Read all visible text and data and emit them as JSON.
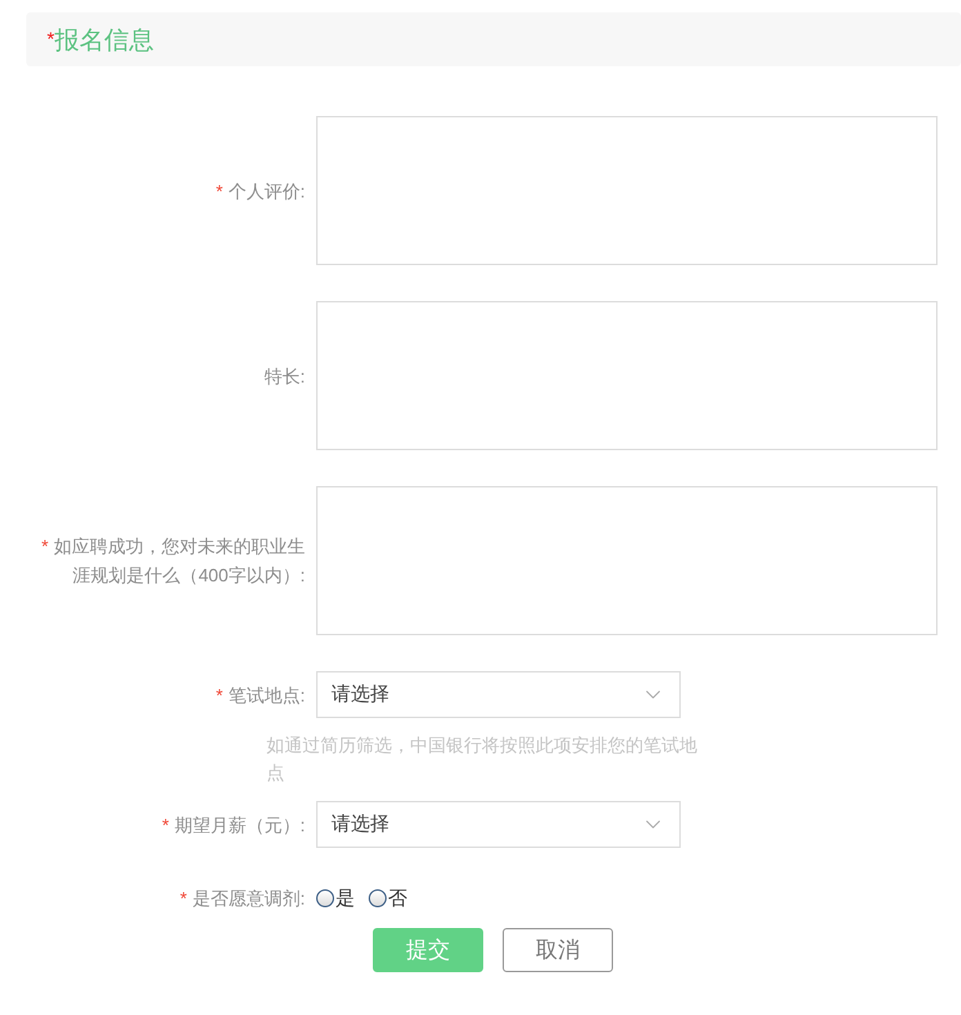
{
  "section": {
    "mark": "*",
    "title": "报名信息"
  },
  "fields": [
    {
      "kind": "textarea",
      "mark": "*",
      "label": "个人评价:"
    },
    {
      "kind": "textarea",
      "label": "特长:"
    },
    {
      "kind": "textarea",
      "mark": "*",
      "label": "如应聘成功，您对未来的职业生涯规划是什么（400字以内）:"
    },
    {
      "kind": "select",
      "mark": "*",
      "label": "笔试地点:",
      "placeholder": "请选择",
      "hint": "如通过简历筛选，中国银行将按照此项安排您的笔试地点"
    },
    {
      "kind": "select",
      "mark": "*",
      "label": "期望月薪（元）:",
      "placeholder": "请选择"
    },
    {
      "kind": "radio",
      "mark": "*",
      "label": "是否愿意调剂:",
      "options": [
        {
          "label": "是",
          "selected": false
        },
        {
          "label": "否",
          "selected": false
        }
      ]
    }
  ],
  "buttons": [
    {
      "kind": "primary",
      "label": "提交"
    },
    {
      "kind": "secondary",
      "label": "取消"
    }
  ]
}
